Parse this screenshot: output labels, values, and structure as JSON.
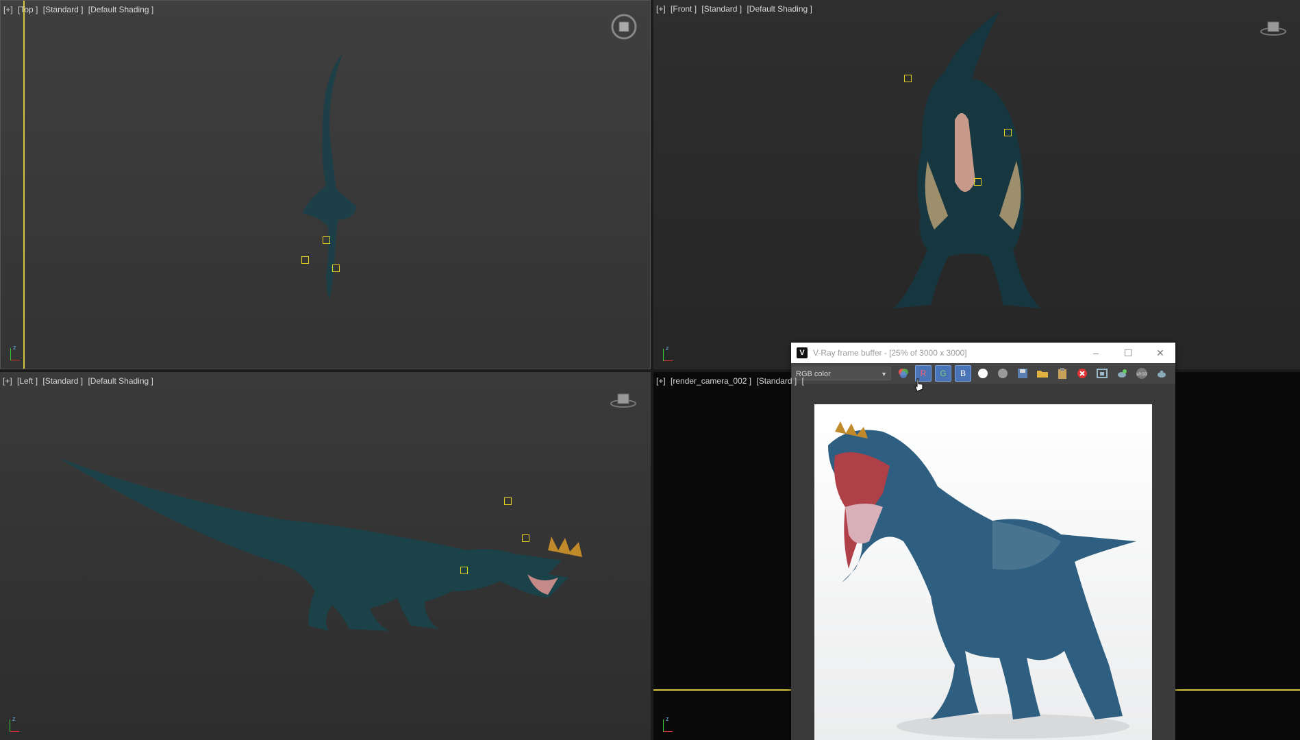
{
  "viewports": {
    "top": {
      "labels": [
        "[+]",
        "[Top ]",
        "[Standard ]",
        "[Default Shading ]"
      ]
    },
    "front": {
      "labels": [
        "[+]",
        "[Front ]",
        "[Standard ]",
        "[Default Shading ]"
      ]
    },
    "left": {
      "labels": [
        "[+]",
        "[Left ]",
        "[Standard ]",
        "[Default Shading ]"
      ]
    },
    "camera": {
      "labels": [
        "[+]",
        "[render_camera_002 ]",
        "[Standard ]",
        "["
      ]
    }
  },
  "vfb": {
    "title": "V-Ray frame buffer - [25% of 3000 x 3000]",
    "logo": "V",
    "minimize": "–",
    "maximize": "☐",
    "close": "✕",
    "channel": "RGB color",
    "buttons": {
      "r": "R",
      "g": "G",
      "b": "B"
    },
    "icons": [
      "rgb-circles-icon",
      "red-channel-icon",
      "green-channel-icon",
      "blue-channel-icon",
      "white-circle-icon",
      "grey-circle-icon",
      "save-icon",
      "open-folder-icon",
      "clipboard-icon",
      "clear-icon",
      "region-render-icon",
      "render-teapot-icon",
      "srgb-icon",
      "teapot-icon"
    ],
    "srgb_label": "sRGB"
  },
  "colors": {
    "accent_yellow": "#e6d01f",
    "dino_teal": "#1f4a54"
  }
}
